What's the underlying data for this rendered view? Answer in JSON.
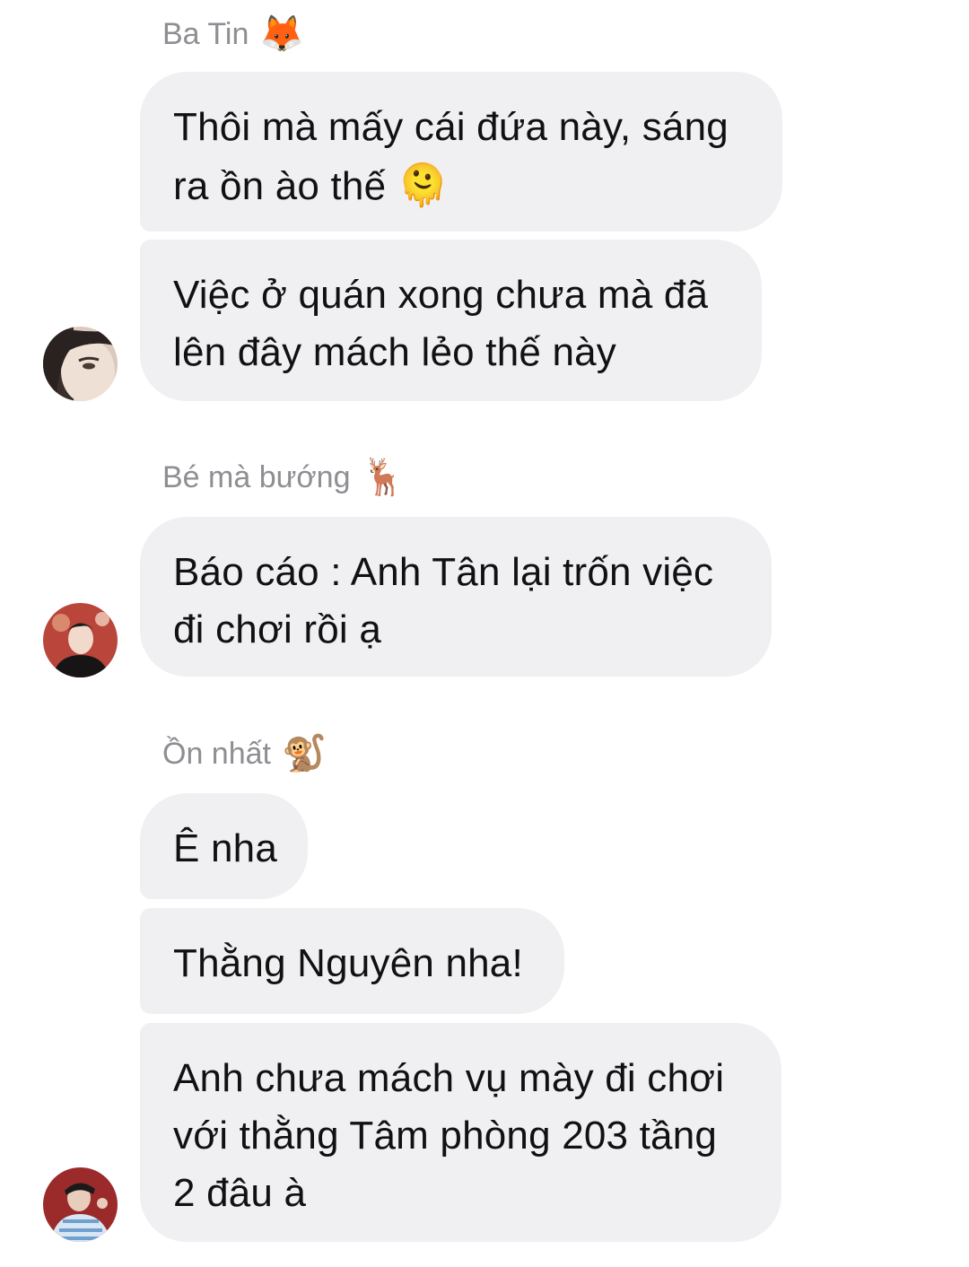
{
  "groups": [
    {
      "sender": "Ba Tin",
      "sender_emoji": "🦊",
      "avatar": "avatar-woman-closeup",
      "messages": [
        {
          "lines": [
            "Thôi mà mấy cái đứa này, sáng",
            "ra ồn ào thế"
          ],
          "emoji": "🫠"
        },
        {
          "lines": [
            "Việc ở quán xong chưa mà đã",
            "lên đây mách lẻo thế này"
          ]
        }
      ]
    },
    {
      "sender": "Bé mà bướng",
      "sender_emoji": "🦌",
      "avatar": "avatar-man-dark-shirt",
      "messages": [
        {
          "lines": [
            "Báo cáo : Anh Tân lại trốn việc",
            "đi chơi rồi ạ"
          ]
        }
      ]
    },
    {
      "sender": "Ồn nhất",
      "sender_emoji": "🐒",
      "avatar": "avatar-man-striped-shirt",
      "messages": [
        {
          "lines": [
            "Ê nha"
          ]
        },
        {
          "lines": [
            "Thằng Nguyên nha!"
          ]
        },
        {
          "lines": [
            "Anh chưa mách vụ mày đi chơi",
            "với thằng Tâm phòng 203 tầng",
            "2 đâu à"
          ]
        }
      ]
    }
  ]
}
